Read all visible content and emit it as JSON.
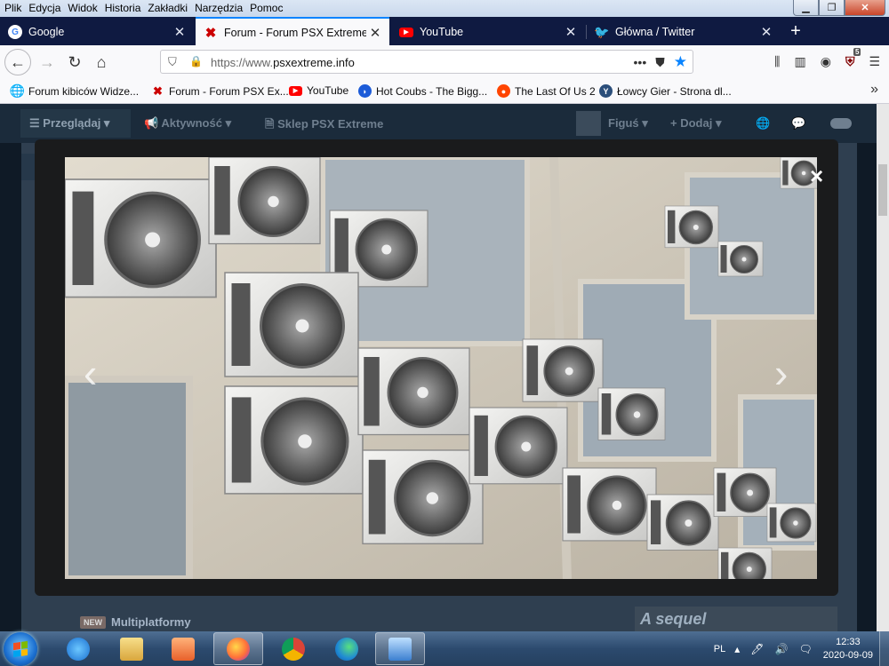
{
  "menubar": {
    "items": [
      "Plik",
      "Edycja",
      "Widok",
      "Historia",
      "Zakładki",
      "Narzędzia",
      "Pomoc"
    ]
  },
  "tabs": [
    {
      "title": "Google",
      "icon": "google-icon",
      "active": false
    },
    {
      "title": "Forum - Forum PSX Extreme",
      "icon": "psx-extreme-icon",
      "active": true
    },
    {
      "title": "YouTube",
      "icon": "youtube-icon",
      "active": false
    },
    {
      "title": "Główna / Twitter",
      "icon": "twitter-icon",
      "active": false
    }
  ],
  "newtab_label": "+",
  "url": {
    "prefix": "https://www.",
    "domain": "psxextreme.info"
  },
  "ublock_count": "5",
  "bookmarks": [
    {
      "title": "Forum kibiców Widze...",
      "icon": "globe-icon"
    },
    {
      "title": "Forum - Forum PSX Ex...",
      "icon": "psx-extreme-icon"
    },
    {
      "title": "YouTube",
      "icon": "youtube-icon"
    },
    {
      "title": "Hot Coubs - The Bigg...",
      "icon": "coub-icon"
    },
    {
      "title": "The Last Of Us 2",
      "icon": "reddit-icon"
    },
    {
      "title": "Łowcy Gier - Strona dl...",
      "icon": "lowcy-gier-icon"
    }
  ],
  "site_nav": {
    "browse": "Przeglądaj",
    "activity": "Aktywność",
    "shop": "Sklep PSX Extreme",
    "user": "Figuś",
    "add": "Dodaj"
  },
  "forum": {
    "badge": "NEW",
    "name": "Multiplatformy"
  },
  "sequel_text": "A sequel",
  "lightbox": {
    "close": "×",
    "prev": "‹",
    "next": "›"
  },
  "tray": {
    "lang": "PL",
    "time": "12:33",
    "date": "2020-09-09"
  },
  "colors": {
    "tab_accent": "#0a84ff",
    "tabstrip_bg": "#0f1a41",
    "site_nav_bg": "#1b2b3b"
  }
}
